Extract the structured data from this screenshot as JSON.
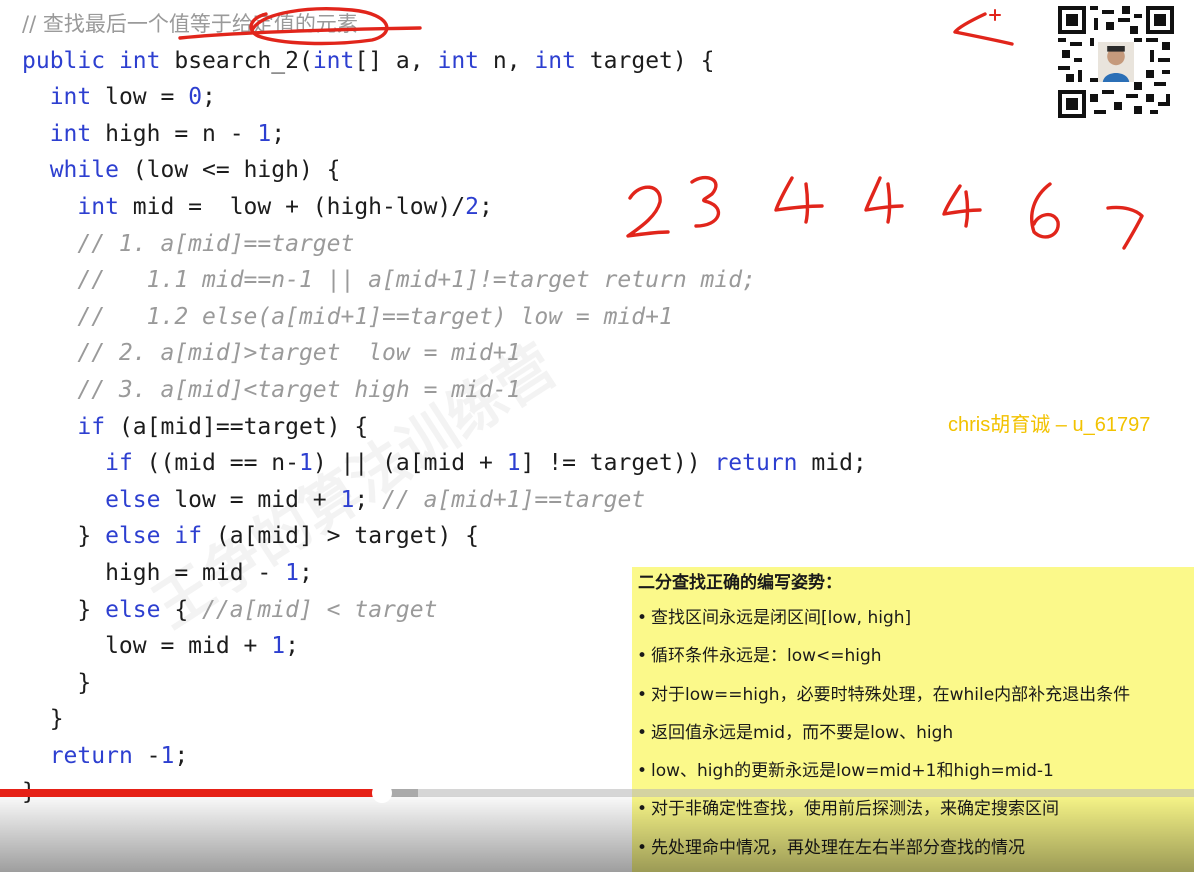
{
  "code": {
    "title_comment": "// 查找最后一个值等于给定值的元素",
    "lines": [
      [
        {
          "t": "kw",
          "v": "public"
        },
        {
          "t": "p",
          "v": " "
        },
        {
          "t": "kw",
          "v": "int"
        },
        {
          "t": "p",
          "v": " bsearch_2("
        },
        {
          "t": "kw",
          "v": "int"
        },
        {
          "t": "p",
          "v": "[] a, "
        },
        {
          "t": "kw",
          "v": "int"
        },
        {
          "t": "p",
          "v": " n, "
        },
        {
          "t": "kw",
          "v": "int"
        },
        {
          "t": "p",
          "v": " target) {"
        }
      ],
      [
        {
          "t": "p",
          "v": "  "
        },
        {
          "t": "kw",
          "v": "int"
        },
        {
          "t": "p",
          "v": " low = "
        },
        {
          "t": "num",
          "v": "0"
        },
        {
          "t": "p",
          "v": ";"
        }
      ],
      [
        {
          "t": "p",
          "v": "  "
        },
        {
          "t": "kw",
          "v": "int"
        },
        {
          "t": "p",
          "v": " high = n - "
        },
        {
          "t": "num",
          "v": "1"
        },
        {
          "t": "p",
          "v": ";"
        }
      ],
      [
        {
          "t": "p",
          "v": "  "
        },
        {
          "t": "kw",
          "v": "while"
        },
        {
          "t": "p",
          "v": " (low <= high) {"
        }
      ],
      [
        {
          "t": "p",
          "v": "    "
        },
        {
          "t": "kw",
          "v": "int"
        },
        {
          "t": "p",
          "v": " mid =  low + (high-low)/"
        },
        {
          "t": "num",
          "v": "2"
        },
        {
          "t": "p",
          "v": ";"
        }
      ],
      [
        {
          "t": "p",
          "v": "    "
        },
        {
          "t": "cmt",
          "v": "// 1. a[mid]==target"
        }
      ],
      [
        {
          "t": "p",
          "v": "    "
        },
        {
          "t": "cmt",
          "v": "//   1.1 mid==n-1 || a[mid+1]!=target return mid;"
        }
      ],
      [
        {
          "t": "p",
          "v": "    "
        },
        {
          "t": "cmt",
          "v": "//   1.2 else(a[mid+1]==target) low = mid+1"
        }
      ],
      [
        {
          "t": "p",
          "v": "    "
        },
        {
          "t": "cmt",
          "v": "// 2. a[mid]>target  low = mid+1"
        }
      ],
      [
        {
          "t": "p",
          "v": "    "
        },
        {
          "t": "cmt",
          "v": "// 3. a[mid]<target high = mid-1"
        }
      ],
      [
        {
          "t": "p",
          "v": "    "
        },
        {
          "t": "kw",
          "v": "if"
        },
        {
          "t": "p",
          "v": " (a[mid]==target) {"
        }
      ],
      [
        {
          "t": "p",
          "v": "      "
        },
        {
          "t": "kw",
          "v": "if"
        },
        {
          "t": "p",
          "v": " ((mid == n-"
        },
        {
          "t": "num",
          "v": "1"
        },
        {
          "t": "p",
          "v": ") || (a[mid + "
        },
        {
          "t": "num",
          "v": "1"
        },
        {
          "t": "p",
          "v": "] != target)) "
        },
        {
          "t": "kw",
          "v": "return"
        },
        {
          "t": "p",
          "v": " mid;"
        }
      ],
      [
        {
          "t": "p",
          "v": "      "
        },
        {
          "t": "kw",
          "v": "else"
        },
        {
          "t": "p",
          "v": " low = mid + "
        },
        {
          "t": "num",
          "v": "1"
        },
        {
          "t": "p",
          "v": "; "
        },
        {
          "t": "cmt",
          "v": "// a[mid+1]==target"
        }
      ],
      [
        {
          "t": "p",
          "v": "    } "
        },
        {
          "t": "kw",
          "v": "else"
        },
        {
          "t": "p",
          "v": " "
        },
        {
          "t": "kw",
          "v": "if"
        },
        {
          "t": "p",
          "v": " (a[mid] > target) {"
        }
      ],
      [
        {
          "t": "p",
          "v": "      high = mid - "
        },
        {
          "t": "num",
          "v": "1"
        },
        {
          "t": "p",
          "v": ";"
        }
      ],
      [
        {
          "t": "p",
          "v": "    } "
        },
        {
          "t": "kw",
          "v": "else"
        },
        {
          "t": "p",
          "v": " { "
        },
        {
          "t": "cmt",
          "v": "//a[mid] < target"
        }
      ],
      [
        {
          "t": "p",
          "v": "      low = mid + "
        },
        {
          "t": "num",
          "v": "1"
        },
        {
          "t": "p",
          "v": ";"
        }
      ],
      [
        {
          "t": "p",
          "v": "    }"
        }
      ],
      [
        {
          "t": "p",
          "v": "  }"
        }
      ],
      [
        {
          "t": "p",
          "v": "  "
        },
        {
          "t": "kw",
          "v": "return"
        },
        {
          "t": "p",
          "v": " -"
        },
        {
          "t": "num",
          "v": "1"
        },
        {
          "t": "p",
          "v": ";"
        }
      ],
      [
        {
          "t": "p",
          "v": "}"
        }
      ]
    ]
  },
  "handwriting": {
    "digits": "2 3 4 4 4 6 7"
  },
  "credit": "chris胡育诚 – u_61797",
  "note": {
    "title": "二分查找正确的编写姿势：",
    "items": [
      "查找区间永远是闭区间[low, high]",
      "循环条件永远是：low<=high",
      "对于low==high，必要时特殊处理，在while内部补充退出条件",
      "返回值永远是mid，而不要是low、high",
      "low、high的更新永远是low=mid+1和high=mid-1",
      "对于非确定性查找，使用前后探测法，来确定搜索区间",
      "先处理命中情况，再处理在左右半部分查找的情况"
    ]
  },
  "watermark": "王争的算法训练营",
  "player": {
    "progress_fraction": 0.32,
    "buffered_fraction": 0.35
  },
  "colors": {
    "keyword": "#2d3fd0",
    "comment": "#9a9a9a",
    "ink": "#e1251b",
    "note_bg": "#fbf98a",
    "credit": "#f2c200",
    "progress": "#e62117"
  }
}
